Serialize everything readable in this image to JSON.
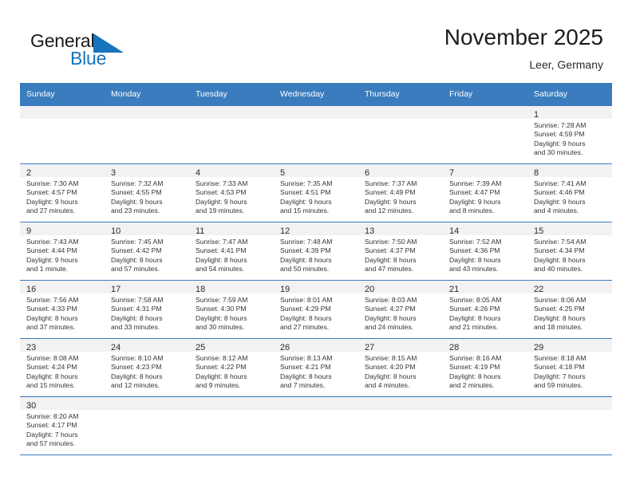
{
  "brand": {
    "name_top": "General",
    "name_bottom": "Blue",
    "triangle_color": "#1574bb",
    "text_color": "#1a1a1a"
  },
  "header": {
    "title": "November 2025",
    "subtitle": "Leer, Germany"
  },
  "theme": {
    "header_bg": "#3a7cbe",
    "header_text": "#ffffff",
    "daynum_bg": "#f2f2f2",
    "grid_line": "#3a7cbe",
    "body_text": "#333333"
  },
  "labels": {
    "sunrise_prefix": "Sunrise:",
    "sunset_prefix": "Sunset:",
    "daylight_prefix": "Daylight:"
  },
  "weekdays": [
    "Sunday",
    "Monday",
    "Tuesday",
    "Wednesday",
    "Thursday",
    "Friday",
    "Saturday"
  ],
  "weeks": [
    [
      {
        "empty": true
      },
      {
        "empty": true
      },
      {
        "empty": true
      },
      {
        "empty": true
      },
      {
        "empty": true
      },
      {
        "empty": true
      },
      {
        "day": "1",
        "sunrise": "Sunrise: 7:28 AM",
        "sunset": "Sunset: 4:59 PM",
        "daylight_line1": "Daylight: 9 hours",
        "daylight_line2": "and 30 minutes."
      }
    ],
    [
      {
        "day": "2",
        "sunrise": "Sunrise: 7:30 AM",
        "sunset": "Sunset: 4:57 PM",
        "daylight_line1": "Daylight: 9 hours",
        "daylight_line2": "and 27 minutes."
      },
      {
        "day": "3",
        "sunrise": "Sunrise: 7:32 AM",
        "sunset": "Sunset: 4:55 PM",
        "daylight_line1": "Daylight: 9 hours",
        "daylight_line2": "and 23 minutes."
      },
      {
        "day": "4",
        "sunrise": "Sunrise: 7:33 AM",
        "sunset": "Sunset: 4:53 PM",
        "daylight_line1": "Daylight: 9 hours",
        "daylight_line2": "and 19 minutes."
      },
      {
        "day": "5",
        "sunrise": "Sunrise: 7:35 AM",
        "sunset": "Sunset: 4:51 PM",
        "daylight_line1": "Daylight: 9 hours",
        "daylight_line2": "and 15 minutes."
      },
      {
        "day": "6",
        "sunrise": "Sunrise: 7:37 AM",
        "sunset": "Sunset: 4:49 PM",
        "daylight_line1": "Daylight: 9 hours",
        "daylight_line2": "and 12 minutes."
      },
      {
        "day": "7",
        "sunrise": "Sunrise: 7:39 AM",
        "sunset": "Sunset: 4:47 PM",
        "daylight_line1": "Daylight: 9 hours",
        "daylight_line2": "and 8 minutes."
      },
      {
        "day": "8",
        "sunrise": "Sunrise: 7:41 AM",
        "sunset": "Sunset: 4:46 PM",
        "daylight_line1": "Daylight: 9 hours",
        "daylight_line2": "and 4 minutes."
      }
    ],
    [
      {
        "day": "9",
        "sunrise": "Sunrise: 7:43 AM",
        "sunset": "Sunset: 4:44 PM",
        "daylight_line1": "Daylight: 9 hours",
        "daylight_line2": "and 1 minute."
      },
      {
        "day": "10",
        "sunrise": "Sunrise: 7:45 AM",
        "sunset": "Sunset: 4:42 PM",
        "daylight_line1": "Daylight: 8 hours",
        "daylight_line2": "and 57 minutes."
      },
      {
        "day": "11",
        "sunrise": "Sunrise: 7:47 AM",
        "sunset": "Sunset: 4:41 PM",
        "daylight_line1": "Daylight: 8 hours",
        "daylight_line2": "and 54 minutes."
      },
      {
        "day": "12",
        "sunrise": "Sunrise: 7:48 AM",
        "sunset": "Sunset: 4:39 PM",
        "daylight_line1": "Daylight: 8 hours",
        "daylight_line2": "and 50 minutes."
      },
      {
        "day": "13",
        "sunrise": "Sunrise: 7:50 AM",
        "sunset": "Sunset: 4:37 PM",
        "daylight_line1": "Daylight: 8 hours",
        "daylight_line2": "and 47 minutes."
      },
      {
        "day": "14",
        "sunrise": "Sunrise: 7:52 AM",
        "sunset": "Sunset: 4:36 PM",
        "daylight_line1": "Daylight: 8 hours",
        "daylight_line2": "and 43 minutes."
      },
      {
        "day": "15",
        "sunrise": "Sunrise: 7:54 AM",
        "sunset": "Sunset: 4:34 PM",
        "daylight_line1": "Daylight: 8 hours",
        "daylight_line2": "and 40 minutes."
      }
    ],
    [
      {
        "day": "16",
        "sunrise": "Sunrise: 7:56 AM",
        "sunset": "Sunset: 4:33 PM",
        "daylight_line1": "Daylight: 8 hours",
        "daylight_line2": "and 37 minutes."
      },
      {
        "day": "17",
        "sunrise": "Sunrise: 7:58 AM",
        "sunset": "Sunset: 4:31 PM",
        "daylight_line1": "Daylight: 8 hours",
        "daylight_line2": "and 33 minutes."
      },
      {
        "day": "18",
        "sunrise": "Sunrise: 7:59 AM",
        "sunset": "Sunset: 4:30 PM",
        "daylight_line1": "Daylight: 8 hours",
        "daylight_line2": "and 30 minutes."
      },
      {
        "day": "19",
        "sunrise": "Sunrise: 8:01 AM",
        "sunset": "Sunset: 4:29 PM",
        "daylight_line1": "Daylight: 8 hours",
        "daylight_line2": "and 27 minutes."
      },
      {
        "day": "20",
        "sunrise": "Sunrise: 8:03 AM",
        "sunset": "Sunset: 4:27 PM",
        "daylight_line1": "Daylight: 8 hours",
        "daylight_line2": "and 24 minutes."
      },
      {
        "day": "21",
        "sunrise": "Sunrise: 8:05 AM",
        "sunset": "Sunset: 4:26 PM",
        "daylight_line1": "Daylight: 8 hours",
        "daylight_line2": "and 21 minutes."
      },
      {
        "day": "22",
        "sunrise": "Sunrise: 8:06 AM",
        "sunset": "Sunset: 4:25 PM",
        "daylight_line1": "Daylight: 8 hours",
        "daylight_line2": "and 18 minutes."
      }
    ],
    [
      {
        "day": "23",
        "sunrise": "Sunrise: 8:08 AM",
        "sunset": "Sunset: 4:24 PM",
        "daylight_line1": "Daylight: 8 hours",
        "daylight_line2": "and 15 minutes."
      },
      {
        "day": "24",
        "sunrise": "Sunrise: 8:10 AM",
        "sunset": "Sunset: 4:23 PM",
        "daylight_line1": "Daylight: 8 hours",
        "daylight_line2": "and 12 minutes."
      },
      {
        "day": "25",
        "sunrise": "Sunrise: 8:12 AM",
        "sunset": "Sunset: 4:22 PM",
        "daylight_line1": "Daylight: 8 hours",
        "daylight_line2": "and 9 minutes."
      },
      {
        "day": "26",
        "sunrise": "Sunrise: 8:13 AM",
        "sunset": "Sunset: 4:21 PM",
        "daylight_line1": "Daylight: 8 hours",
        "daylight_line2": "and 7 minutes."
      },
      {
        "day": "27",
        "sunrise": "Sunrise: 8:15 AM",
        "sunset": "Sunset: 4:20 PM",
        "daylight_line1": "Daylight: 8 hours",
        "daylight_line2": "and 4 minutes."
      },
      {
        "day": "28",
        "sunrise": "Sunrise: 8:16 AM",
        "sunset": "Sunset: 4:19 PM",
        "daylight_line1": "Daylight: 8 hours",
        "daylight_line2": "and 2 minutes."
      },
      {
        "day": "29",
        "sunrise": "Sunrise: 8:18 AM",
        "sunset": "Sunset: 4:18 PM",
        "daylight_line1": "Daylight: 7 hours",
        "daylight_line2": "and 59 minutes."
      }
    ],
    [
      {
        "day": "30",
        "sunrise": "Sunrise: 8:20 AM",
        "sunset": "Sunset: 4:17 PM",
        "daylight_line1": "Daylight: 7 hours",
        "daylight_line2": "and 57 minutes."
      },
      {
        "empty": true
      },
      {
        "empty": true
      },
      {
        "empty": true
      },
      {
        "empty": true
      },
      {
        "empty": true
      },
      {
        "empty": true
      }
    ]
  ]
}
